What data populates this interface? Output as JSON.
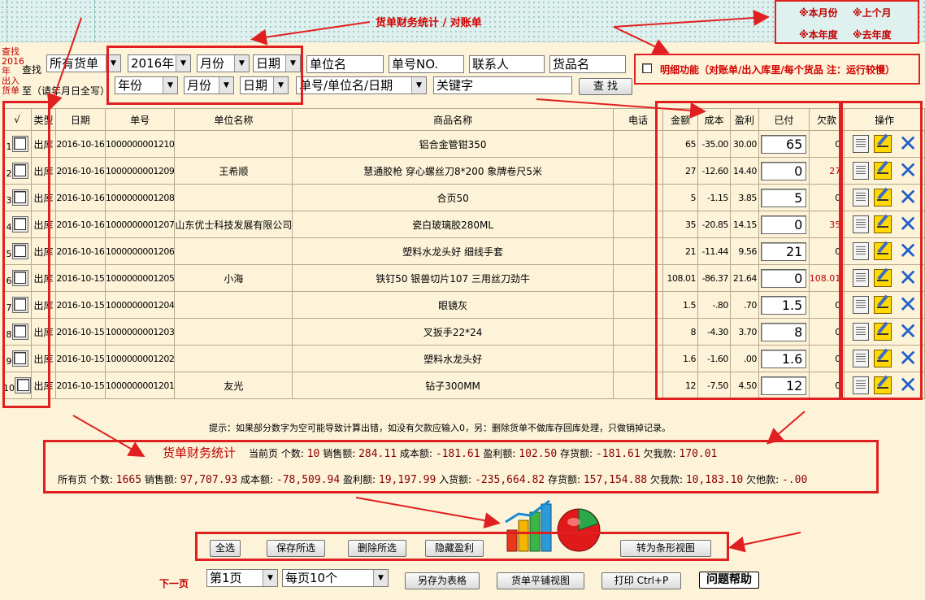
{
  "header": {
    "title": "货单财务统计 / 对账单",
    "periods": [
      "※本月份",
      "※上个月",
      "※本年度",
      "※去年度"
    ]
  },
  "side_label": [
    "查找",
    "2016",
    "年",
    "出入",
    "货单"
  ],
  "search": {
    "row1": {
      "label": "查找",
      "type_select": "所有货单",
      "year_select": "2016年",
      "month_select": "月份",
      "day_select": "日期",
      "unit_field": "单位名",
      "order_field": "单号NO.",
      "contact_field": "联系人",
      "goods_field": "货品名"
    },
    "row2": {
      "label": "至（请年月日全写）",
      "year_select": "年份",
      "month_select": "月份",
      "day_select": "日期",
      "field_select": "单号/单位名/日期",
      "keyword_field": "关键字",
      "find_button": "查 找"
    },
    "detail_option": "明细功能（对账单/出入库里/每个货品 注：运行较慢）"
  },
  "table": {
    "columns": [
      "√",
      "类型",
      "日期",
      "单号",
      "单位名称",
      "商品名称",
      "电话",
      "金额",
      "成本",
      "盈利",
      "已付",
      "欠款",
      "操作"
    ],
    "rows": [
      {
        "n": "1",
        "type": "出库",
        "date": "2016-10-16",
        "no": "1000000001210",
        "unit": "",
        "goods": "铝合金管钳350",
        "phone": "",
        "amount": "65",
        "cost": "-35.00",
        "profit": "30.00",
        "paid": "65",
        "owe": "0"
      },
      {
        "n": "2",
        "type": "出库",
        "date": "2016-10-16",
        "no": "1000000001209",
        "unit": "王希顺",
        "goods": "慧通胶枪 穿心螺丝刀8*200 象牌卷尺5米",
        "phone": "",
        "amount": "27",
        "cost": "-12.60",
        "profit": "14.40",
        "paid": "0",
        "owe": "27"
      },
      {
        "n": "3",
        "type": "出库",
        "date": "2016-10-16",
        "no": "1000000001208",
        "unit": "",
        "goods": "合页50",
        "phone": "",
        "amount": "5",
        "cost": "-1.15",
        "profit": "3.85",
        "paid": "5",
        "owe": "0"
      },
      {
        "n": "4",
        "type": "出库",
        "date": "2016-10-16",
        "no": "1000000001207",
        "unit": "山东优士科技发展有限公司",
        "goods": "瓷白玻璃胶280ML",
        "phone": "",
        "amount": "35",
        "cost": "-20.85",
        "profit": "14.15",
        "paid": "0",
        "owe": "35"
      },
      {
        "n": "5",
        "type": "出库",
        "date": "2016-10-16",
        "no": "1000000001206",
        "unit": "",
        "goods": "塑料水龙头好 细线手套",
        "phone": "",
        "amount": "21",
        "cost": "-11.44",
        "profit": "9.56",
        "paid": "21",
        "owe": "0"
      },
      {
        "n": "6",
        "type": "出库",
        "date": "2016-10-15",
        "no": "1000000001205",
        "unit": "小海",
        "goods": "铁钉50 银兽切片107 三用丝刀劲牛",
        "phone": "",
        "amount": "108.01",
        "cost": "-86.37",
        "profit": "21.64",
        "paid": "0",
        "owe": "108.01"
      },
      {
        "n": "7",
        "type": "出库",
        "date": "2016-10-15",
        "no": "1000000001204",
        "unit": "",
        "goods": "眼镜灰",
        "phone": "",
        "amount": "1.5",
        "cost": "-.80",
        "profit": ".70",
        "paid": "1.5",
        "owe": "0"
      },
      {
        "n": "8",
        "type": "出库",
        "date": "2016-10-15",
        "no": "1000000001203",
        "unit": "",
        "goods": "叉扳手22*24",
        "phone": "",
        "amount": "8",
        "cost": "-4.30",
        "profit": "3.70",
        "paid": "8",
        "owe": "0"
      },
      {
        "n": "9",
        "type": "出库",
        "date": "2016-10-15",
        "no": "1000000001202",
        "unit": "",
        "goods": "塑料水龙头好",
        "phone": "",
        "amount": "1.6",
        "cost": "-1.60",
        "profit": ".00",
        "paid": "1.6",
        "owe": "0"
      },
      {
        "n": "10",
        "type": "出库",
        "date": "2016-10-15",
        "no": "1000000001201",
        "unit": "友光",
        "goods": "钻子300MM",
        "phone": "",
        "amount": "12",
        "cost": "-7.50",
        "profit": "4.50",
        "paid": "12",
        "owe": "0"
      }
    ]
  },
  "tip": "提示：如果部分数字为空可能导致计算出错，如没有欠款应输入0，另：删除货单不做库存回库处理，只做销掉记录。",
  "stats": {
    "title": "货单财务统计",
    "current": {
      "label": "当前页",
      "count_label": "个数:",
      "count": "10",
      "sales_label": "销售额:",
      "sales": "284.11",
      "cost_label": "成本额:",
      "cost": "-181.61",
      "profit_label": "盈利额:",
      "profit": "102.50",
      "stock_label": "存货额:",
      "stock": "-181.61",
      "owe_label": "欠我款:",
      "owe": "170.01"
    },
    "all": {
      "label": "所有页",
      "count_label": "个数:",
      "count": "1665",
      "sales_label": "销售额:",
      "sales": "97,707.93",
      "cost_label": "成本额:",
      "cost": "-78,509.94",
      "profit_label": "盈利额:",
      "profit": "19,197.99",
      "in_label": "入货额:",
      "in": "-235,664.82",
      "stock_label": "存货额:",
      "stock": "157,154.88",
      "owe_me_label": "欠我款:",
      "owe_me": "10,183.10",
      "owe_him_label": "欠他款:",
      "owe_him": "-.00"
    }
  },
  "actions": {
    "select_all": "全选",
    "save_selected": "保存所选",
    "delete_selected": "删除所选",
    "hide_profit": "隐藏盈利",
    "bar_view": "转为条形视图"
  },
  "footer": {
    "next_page": "下一页",
    "page_select": "第1页",
    "per_page_select": "每页10个",
    "save_table": "另存为表格",
    "flat_view": "货单平铺视图",
    "print": "打印 Ctrl+P",
    "help": "问题帮助"
  },
  "colors": {
    "accent_red": "#e02020",
    "value_red": "#8a0000",
    "background": "#fdf3d9"
  }
}
